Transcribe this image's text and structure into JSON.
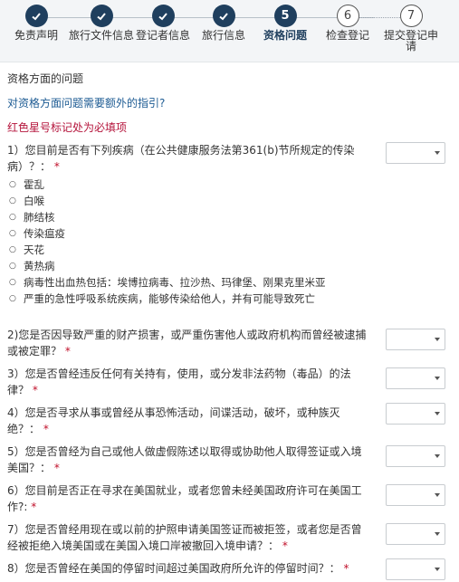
{
  "stepper": {
    "steps": [
      {
        "label": "免责声明",
        "state": "done"
      },
      {
        "label": "旅行文件信息",
        "state": "done"
      },
      {
        "label": "登记者信息",
        "state": "done"
      },
      {
        "label": "旅行信息",
        "state": "done"
      },
      {
        "number": "5",
        "label": "资格问题",
        "state": "current"
      },
      {
        "number": "6",
        "label": "检查登记",
        "state": "todo"
      },
      {
        "number": "7",
        "label": "提交登记申请",
        "state": "todo"
      }
    ]
  },
  "section": {
    "title": "资格方面的问题",
    "guide_link": "对资格方面问题需要额外的指引?",
    "required_note": "红色星号标记处为必填项"
  },
  "questions": [
    {
      "text": "1）您目前是否有下列疾病（在公共健康服务法第361(b)节所规定的传染病）？：",
      "star": "*"
    },
    {
      "text": "2)您是否因导致严重的财产损害，或严重伤害他人或政府机构而曾经被逮捕或被定罪？",
      "star": "*"
    },
    {
      "text": "3）您是否曾经违反任何有关持有，使用，或分发非法药物（毒品）的法律？",
      "star": "*"
    },
    {
      "text": "4）您是否寻求从事或曾经从事恐怖活动，间谍活动，破坏，或种族灭绝？：",
      "star": "*"
    },
    {
      "text": "5）您是否曾经为自己或他人做虚假陈述以取得或协助他人取得签证或入境美国？：",
      "star": "*"
    },
    {
      "text": "6）您目前是否正在寻求在美国就业，或者您曾未经美国政府许可在美国工作?:",
      "star": "*"
    },
    {
      "text": "7）您是否曾经用现在或以前的护照申请美国签证而被拒签，或者您是否曾经被拒绝入境美国或在美国入境口岸被撤回入境申请？：",
      "star": "*"
    },
    {
      "text": "8）您是否曾经在美国的停留时间超过美国政府所允许的停留时间？：",
      "star": "*"
    }
  ],
  "diseases": [
    "霍乱",
    "白喉",
    "肺结核",
    "传染瘟疫",
    "天花",
    "黄热病",
    "病毒性出血热包括：埃博拉病毒、拉沙热、玛律堡、刚果克里米亚",
    "严重的急性呼吸系统疾病，能够传染给他人，并有可能导致死亡"
  ],
  "colors": {
    "nav": "#1f3f5e",
    "link": "#1d5b93",
    "required": "#b5153c",
    "star": "#c0102a"
  }
}
